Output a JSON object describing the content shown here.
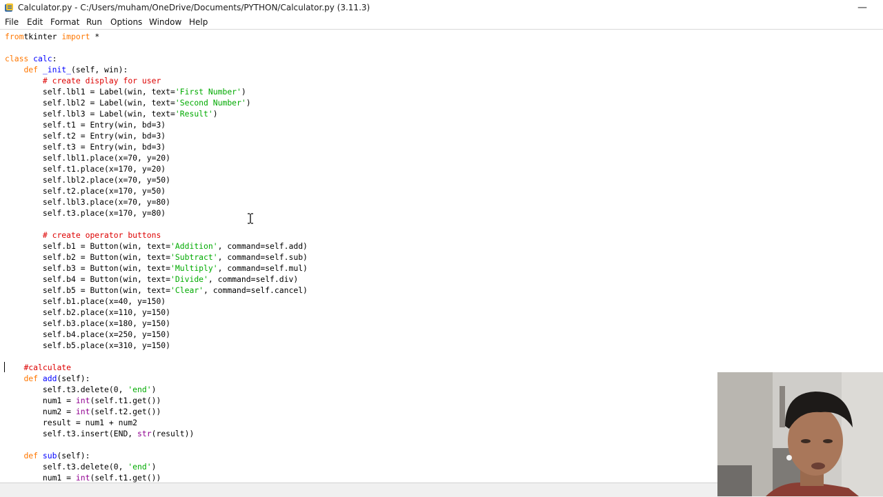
{
  "window": {
    "title": "Calculator.py - C:/Users/muham/OneDrive/Documents/PYTHON/Calculator.py (3.11.3)",
    "minimize_label": "—"
  },
  "menu": [
    "File",
    "Edit",
    "Format",
    "Run",
    "Options",
    "Window",
    "Help"
  ],
  "code": [
    [
      [
        "kw",
        "from"
      ],
      [
        "",
        "tkinter "
      ],
      [
        "kw",
        "import"
      ],
      [
        "",
        " *"
      ]
    ],
    [],
    [
      [
        "kw",
        "class "
      ],
      [
        "df",
        "calc"
      ],
      [
        "",
        ":"
      ]
    ],
    [
      [
        "",
        "    "
      ],
      [
        "kw",
        "def "
      ],
      [
        "df",
        "_init_"
      ],
      [
        "",
        "(self, win):"
      ]
    ],
    [
      [
        "",
        "        "
      ],
      [
        "cm",
        "# create display for user"
      ]
    ],
    [
      [
        "",
        "        self.lbl1 = Label(win, text="
      ],
      [
        "str",
        "'First Number'"
      ],
      [
        "",
        ")"
      ]
    ],
    [
      [
        "",
        "        self.lbl2 = Label(win, text="
      ],
      [
        "str",
        "'Second Number'"
      ],
      [
        "",
        ")"
      ]
    ],
    [
      [
        "",
        "        self.lbl3 = Label(win, text="
      ],
      [
        "str",
        "'Result'"
      ],
      [
        "",
        ")"
      ]
    ],
    [
      [
        "",
        "        self.t1 = Entry(win, bd=3)"
      ]
    ],
    [
      [
        "",
        "        self.t2 = Entry(win, bd=3)"
      ]
    ],
    [
      [
        "",
        "        self.t3 = Entry(win, bd=3)"
      ]
    ],
    [
      [
        "",
        "        self.lbl1.place(x=70, y=20)"
      ]
    ],
    [
      [
        "",
        "        self.t1.place(x=170, y=20)"
      ]
    ],
    [
      [
        "",
        "        self.lbl2.place(x=70, y=50)"
      ]
    ],
    [
      [
        "",
        "        self.t2.place(x=170, y=50)"
      ]
    ],
    [
      [
        "",
        "        self.lbl3.place(x=70, y=80)"
      ]
    ],
    [
      [
        "",
        "        self.t3.place(x=170, y=80)"
      ]
    ],
    [],
    [
      [
        "",
        "        "
      ],
      [
        "cm",
        "# create operator buttons"
      ]
    ],
    [
      [
        "",
        "        self.b1 = Button(win, text="
      ],
      [
        "str",
        "'Addition'"
      ],
      [
        "",
        ", command=self.add)"
      ]
    ],
    [
      [
        "",
        "        self.b2 = Button(win, text="
      ],
      [
        "str",
        "'Subtract'"
      ],
      [
        "",
        ", command=self.sub)"
      ]
    ],
    [
      [
        "",
        "        self.b3 = Button(win, text="
      ],
      [
        "str",
        "'Multiply'"
      ],
      [
        "",
        ", command=self.mul)"
      ]
    ],
    [
      [
        "",
        "        self.b4 = Button(win, text="
      ],
      [
        "str",
        "'Divide'"
      ],
      [
        "",
        ", command=self.div)"
      ]
    ],
    [
      [
        "",
        "        self.b5 = Button(win, text="
      ],
      [
        "str",
        "'Clear'"
      ],
      [
        "",
        ", command=self.cancel)"
      ]
    ],
    [
      [
        "",
        "        self.b1.place(x=40, y=150)"
      ]
    ],
    [
      [
        "",
        "        self.b2.place(x=110, y=150)"
      ]
    ],
    [
      [
        "",
        "        self.b3.place(x=180, y=150)"
      ]
    ],
    [
      [
        "",
        "        self.b4.place(x=250, y=150)"
      ]
    ],
    [
      [
        "",
        "        self.b5.place(x=310, y=150)"
      ]
    ],
    [],
    [
      [
        "",
        "    "
      ],
      [
        "cm",
        "#calculate"
      ]
    ],
    [
      [
        "",
        "    "
      ],
      [
        "kw",
        "def "
      ],
      [
        "df",
        "add"
      ],
      [
        "",
        "(self):"
      ]
    ],
    [
      [
        "",
        "        self.t3.delete(0, "
      ],
      [
        "str",
        "'end'"
      ],
      [
        "",
        ")"
      ]
    ],
    [
      [
        "",
        "        num1 = "
      ],
      [
        "bi",
        "int"
      ],
      [
        "",
        "(self.t1.get())"
      ]
    ],
    [
      [
        "",
        "        num2 = "
      ],
      [
        "bi",
        "int"
      ],
      [
        "",
        "(self.t2.get())"
      ]
    ],
    [
      [
        "",
        "        result = num1 + num2"
      ]
    ],
    [
      [
        "",
        "        self.t3.insert(END, "
      ],
      [
        "bi",
        "str"
      ],
      [
        "",
        "(result))"
      ]
    ],
    [],
    [
      [
        "",
        "    "
      ],
      [
        "kw",
        "def "
      ],
      [
        "df",
        "sub"
      ],
      [
        "",
        "(self):"
      ]
    ],
    [
      [
        "",
        "        self.t3.delete(0, "
      ],
      [
        "str",
        "'end'"
      ],
      [
        "",
        ")"
      ]
    ],
    [
      [
        "",
        "        num1 = "
      ],
      [
        "bi",
        "int"
      ],
      [
        "",
        "(self.t1.get())"
      ]
    ]
  ]
}
